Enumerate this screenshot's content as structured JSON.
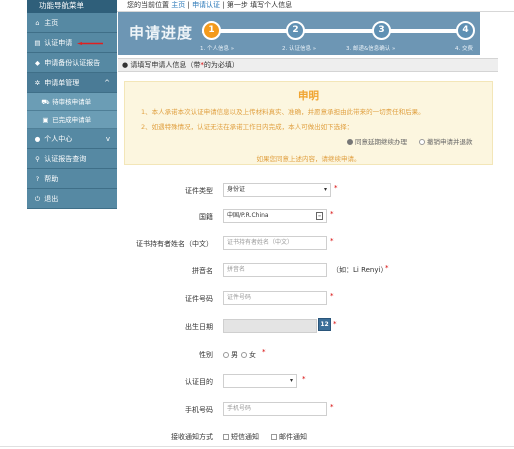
{
  "sidebar": {
    "title": "功能导航菜单",
    "items": [
      {
        "label": "主页",
        "icon": "home-icon"
      },
      {
        "label": "认证申请",
        "icon": "document-icon"
      },
      {
        "label": "申请备份认证报告",
        "icon": "tag-icon"
      },
      {
        "label": "申请单管理",
        "icon": "gear-icon",
        "arrow": "^"
      },
      {
        "label": "待审核申请单",
        "icon": "cart-icon"
      },
      {
        "label": "已完成申请单",
        "icon": "folder-icon"
      },
      {
        "label": "个人中心",
        "icon": "user-icon",
        "arrow": "v"
      },
      {
        "label": "认证报告查询",
        "icon": "search-icon"
      },
      {
        "label": "帮助",
        "icon": "question-icon"
      },
      {
        "label": "退出",
        "icon": "power-icon"
      }
    ],
    "annotation_color": "#e02020"
  },
  "breadcrumb": {
    "prefix": "您的当前位置",
    "home": "主页",
    "sep1": "|",
    "current": "申请认证",
    "sep2": "|",
    "step": "第一步 填写个人信息"
  },
  "progress": {
    "title": "申请进度",
    "steps": [
      {
        "num": "1",
        "label": "1. 个人信息"
      },
      {
        "num": "2",
        "label": "2. 认证信息"
      },
      {
        "num": "3",
        "label": "3. 邮递&信息确认"
      },
      {
        "num": "4",
        "label": "4. 交费"
      }
    ],
    "arrow": "»",
    "active_color": "#f39a1c",
    "bar_color": "#6d96b4"
  },
  "section": {
    "text_prefix": "请填写申请人信息（带",
    "required_mark": "*",
    "text_suffix": "的为必填）"
  },
  "notice": {
    "title": "申明",
    "line1": "1、本人承诺本次认证申请信息以及上传材料真实、准确，并愿意承担由此带来的一切责任和后果。",
    "line2": "2、如遇特殊情况，认证无法在承诺工作日内完成，本人可做出如下选择：",
    "option1": "同意延期继续办理",
    "option2": "撤销申请并退款",
    "footer": "如果您同意上述内容，请继续申请。"
  },
  "form": {
    "doc_type": {
      "label": "证件类型",
      "value": "身份证"
    },
    "nationality": {
      "label": "国籍",
      "value": "中国/P.R.China"
    },
    "holder_name": {
      "label": "证书持有者姓名（中文）",
      "placeholder": "证书持有者姓名（中文）"
    },
    "pinyin": {
      "label": "拼音名",
      "placeholder": "拼音名",
      "hint": "（如：Li Renyi）"
    },
    "doc_no": {
      "label": "证件号码",
      "placeholder": "证件号码"
    },
    "birth": {
      "label": "出生日期",
      "calendar_text": "12"
    },
    "gender": {
      "label": "性别",
      "male": "男",
      "female": "女"
    },
    "purpose": {
      "label": "认证目的",
      "value": ""
    },
    "phone": {
      "label": "手机号码",
      "placeholder": "手机号码"
    },
    "notify": {
      "label": "接收通知方式",
      "sms": "短信通知",
      "email": "邮件通知"
    },
    "required_mark": "*"
  }
}
